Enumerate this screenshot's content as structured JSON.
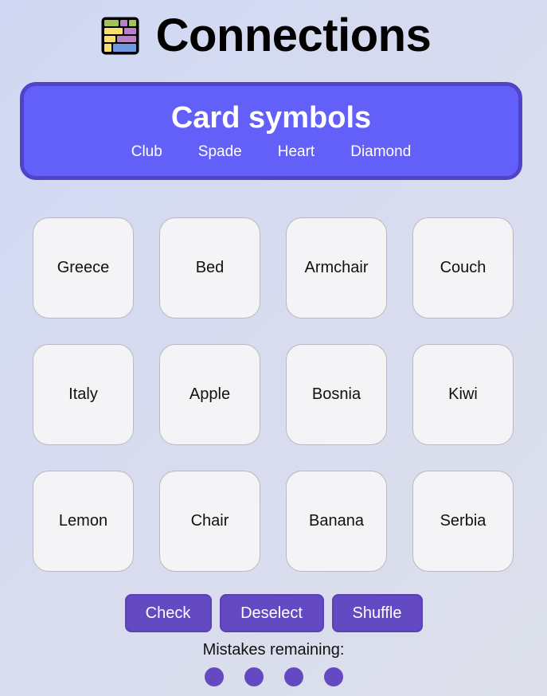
{
  "app": {
    "title": "Connections"
  },
  "solved_group": {
    "title": "Card symbols",
    "words": [
      "Club",
      "Spade",
      "Heart",
      "Diamond"
    ],
    "color": "#6360fa"
  },
  "tiles": [
    "Greece",
    "Bed",
    "Armchair",
    "Couch",
    "Italy",
    "Apple",
    "Bosnia",
    "Kiwi",
    "Lemon",
    "Chair",
    "Banana",
    "Serbia"
  ],
  "controls": {
    "check_label": "Check",
    "deselect_label": "Deselect",
    "shuffle_label": "Shuffle"
  },
  "mistakes": {
    "label": "Mistakes remaining:",
    "remaining": 4
  },
  "colors": {
    "accent": "#6349c2",
    "solved_border": "#5043c8",
    "tile_bg": "#f4f3f6"
  },
  "icons": {
    "logo": "connections-grid-icon"
  }
}
